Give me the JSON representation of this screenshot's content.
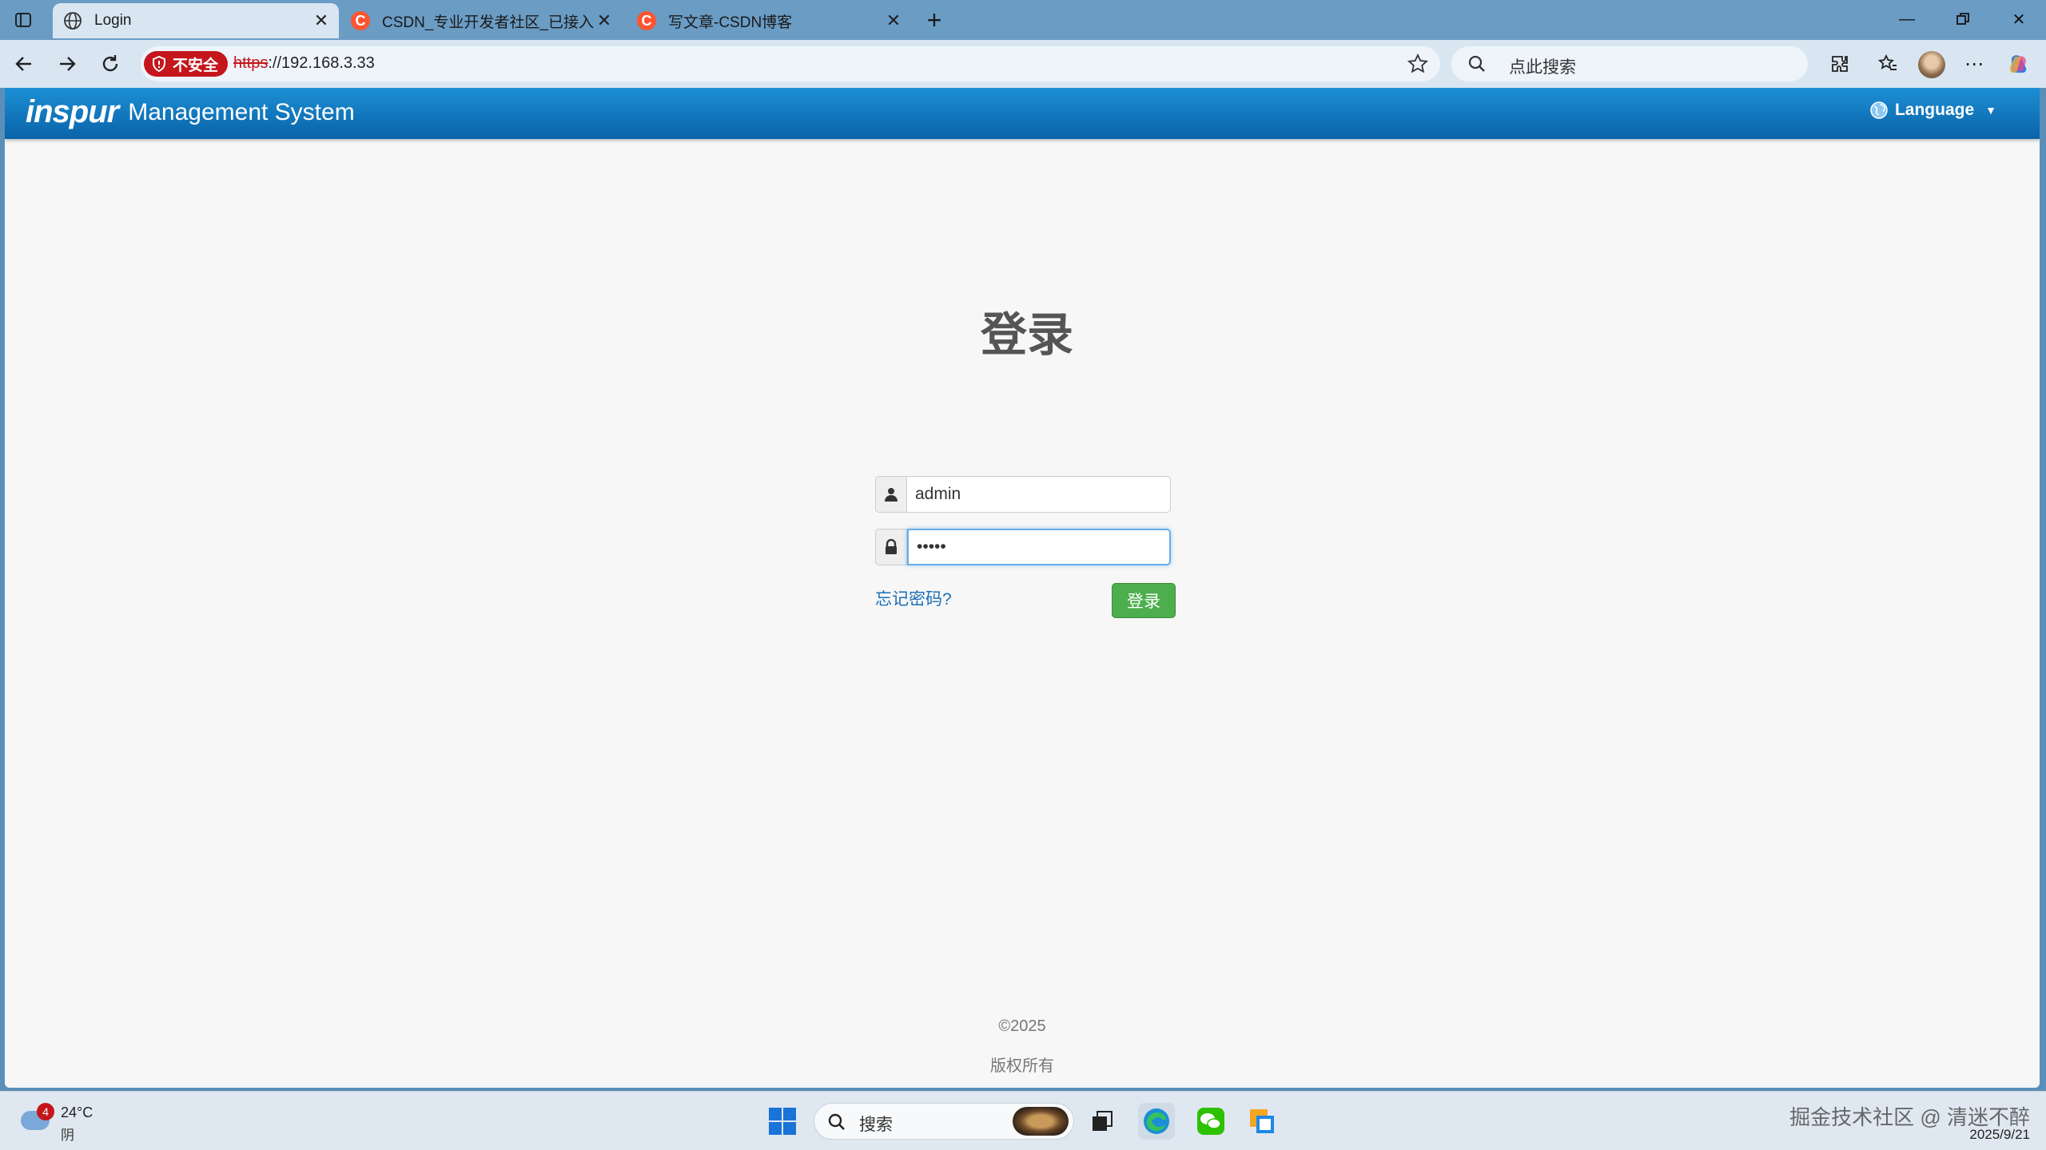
{
  "browser": {
    "tabs": [
      {
        "title": "Login",
        "active": true
      },
      {
        "title": "CSDN_专业开发者社区_已接入De",
        "active": false
      },
      {
        "title": "写文章-CSDN博客",
        "active": false
      }
    ],
    "security_label": "不安全",
    "url_scheme": "https",
    "url_rest": "://192.168.3.33",
    "search_placeholder": "点此搜索"
  },
  "app": {
    "logo": "inspur",
    "system_name": "Management System",
    "language_label": "Language"
  },
  "login": {
    "title": "登录",
    "username": "admin",
    "password": "•••••",
    "forgot_label": "忘记密码?",
    "submit_label": "登录"
  },
  "footer": {
    "copyright": "©2025",
    "rights": "版权所有"
  },
  "taskbar": {
    "weather_badge": "4",
    "temperature": "24°C",
    "condition": "阴",
    "search_placeholder": "搜索",
    "watermark": "掘金技术社区 @ 清迷不醉",
    "date": "2025/9/21"
  },
  "colors": {
    "header_blue": "#0a63a8",
    "login_green": "#4cae4c",
    "insecure_red": "#c4161c"
  }
}
